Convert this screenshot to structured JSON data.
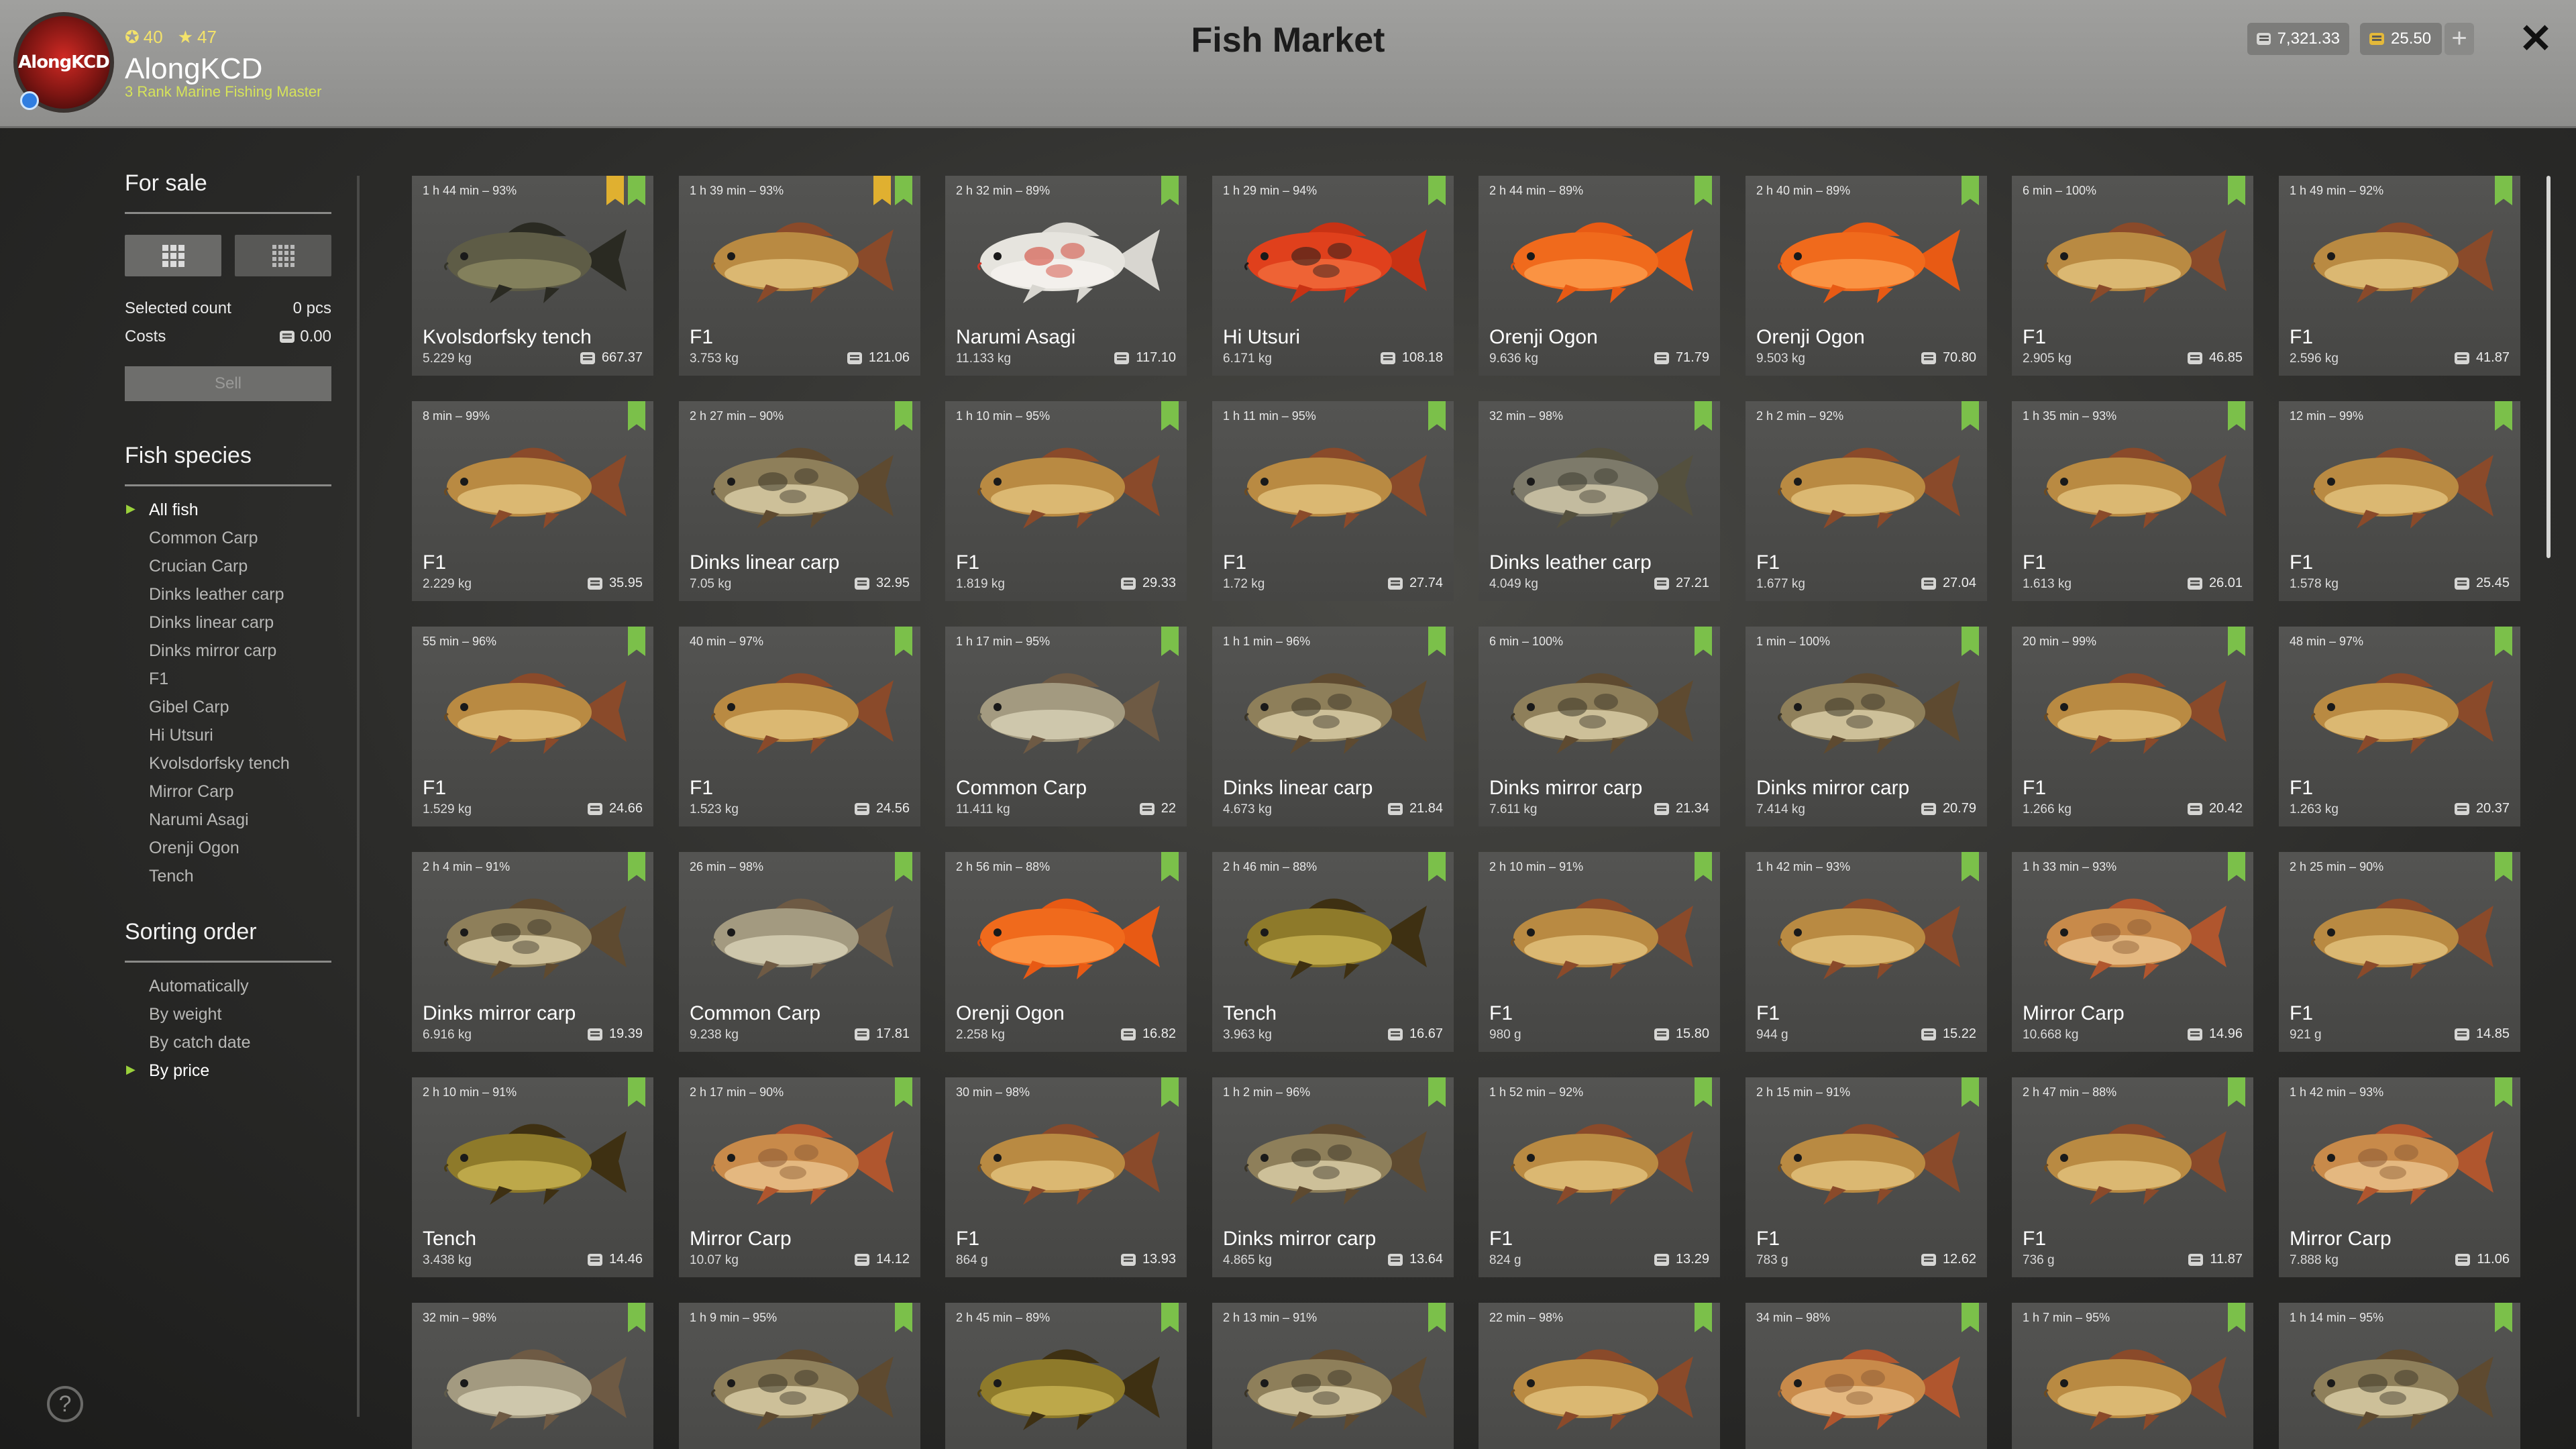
{
  "header": {
    "title": "Fish Market",
    "avatar_logo_text": "AlongKCD",
    "level_primary": "40",
    "level_secondary": "47",
    "username": "AlongKCD",
    "rank": "3 Rank Marine Fishing Master",
    "silver_balance": "7,321.33",
    "gold_balance": "25.50",
    "icons": [
      "circle-level-icon",
      "star-icon",
      "silver-coin-icon",
      "gold-coin-icon",
      "plus-icon",
      "close-icon"
    ]
  },
  "sidebar": {
    "for_sale_title": "For sale",
    "selected_count_label": "Selected count",
    "selected_count_value": "0 pcs",
    "costs_label": "Costs",
    "costs_value": "0.00",
    "sell_label": "Sell",
    "species_title": "Fish species",
    "species": [
      "All fish",
      "Common Carp",
      "Crucian Carp",
      "Dinks leather carp",
      "Dinks linear carp",
      "Dinks mirror carp",
      "F1",
      "Gibel Carp",
      "Hi Utsuri",
      "Kvolsdorfsky tench",
      "Mirror Carp",
      "Narumi Asagi",
      "Orenji Ogon",
      "Tench"
    ],
    "active_species": 0,
    "sorting_title": "Sorting order",
    "sorting": [
      "Automatically",
      "By weight",
      "By catch date",
      "By price"
    ],
    "active_sorting": 3
  },
  "help_label": "?",
  "colors": {
    "accent_green": "#7bc04a",
    "gold": "#e0b030",
    "card_bg": "#4e4e4c"
  },
  "fish": [
    {
      "time": "1 h 44 min – 93%",
      "name": "Kvolsdorfsky tench",
      "weight": "5.229 kg",
      "price": "667.37",
      "gold": true,
      "kind": "tench-dark"
    },
    {
      "time": "1 h 39 min – 93%",
      "name": "F1",
      "weight": "3.753 kg",
      "price": "121.06",
      "gold": true,
      "kind": "carp"
    },
    {
      "time": "2 h 32 min – 89%",
      "name": "Narumi Asagi",
      "weight": "11.133 kg",
      "price": "117.10",
      "gold": false,
      "kind": "koi-white"
    },
    {
      "time": "1 h 29 min – 94%",
      "name": "Hi Utsuri",
      "weight": "6.171 kg",
      "price": "108.18",
      "gold": false,
      "kind": "koi-red"
    },
    {
      "time": "2 h 44 min – 89%",
      "name": "Orenji Ogon",
      "weight": "9.636 kg",
      "price": "71.79",
      "gold": false,
      "kind": "koi-orange"
    },
    {
      "time": "2 h 40 min – 89%",
      "name": "Orenji Ogon",
      "weight": "9.503 kg",
      "price": "70.80",
      "gold": false,
      "kind": "koi-orange"
    },
    {
      "time": "6 min – 100%",
      "name": "F1",
      "weight": "2.905 kg",
      "price": "46.85",
      "gold": false,
      "kind": "carp"
    },
    {
      "time": "1 h 49 min – 92%",
      "name": "F1",
      "weight": "2.596 kg",
      "price": "41.87",
      "gold": false,
      "kind": "carp"
    },
    {
      "time": "8 min – 99%",
      "name": "F1",
      "weight": "2.229 kg",
      "price": "35.95",
      "gold": false,
      "kind": "carp"
    },
    {
      "time": "2 h 27 min – 90%",
      "name": "Dinks linear carp",
      "weight": "7.05 kg",
      "price": "32.95",
      "gold": false,
      "kind": "mirror"
    },
    {
      "time": "1 h 10 min – 95%",
      "name": "F1",
      "weight": "1.819 kg",
      "price": "29.33",
      "gold": false,
      "kind": "carp"
    },
    {
      "time": "1 h 11 min – 95%",
      "name": "F1",
      "weight": "1.72 kg",
      "price": "27.74",
      "gold": false,
      "kind": "carp"
    },
    {
      "time": "32 min – 98%",
      "name": "Dinks leather carp",
      "weight": "4.049 kg",
      "price": "27.21",
      "gold": false,
      "kind": "leather"
    },
    {
      "time": "2 h 2 min – 92%",
      "name": "F1",
      "weight": "1.677 kg",
      "price": "27.04",
      "gold": false,
      "kind": "carp"
    },
    {
      "time": "1 h 35 min – 93%",
      "name": "F1",
      "weight": "1.613 kg",
      "price": "26.01",
      "gold": false,
      "kind": "carp"
    },
    {
      "time": "12 min – 99%",
      "name": "F1",
      "weight": "1.578 kg",
      "price": "25.45",
      "gold": false,
      "kind": "carp"
    },
    {
      "time": "55 min – 96%",
      "name": "F1",
      "weight": "1.529 kg",
      "price": "24.66",
      "gold": false,
      "kind": "carp"
    },
    {
      "time": "40 min – 97%",
      "name": "F1",
      "weight": "1.523 kg",
      "price": "24.56",
      "gold": false,
      "kind": "carp"
    },
    {
      "time": "1 h 17 min – 95%",
      "name": "Common Carp",
      "weight": "11.411 kg",
      "price": "22",
      "gold": false,
      "kind": "common"
    },
    {
      "time": "1 h 1 min – 96%",
      "name": "Dinks linear carp",
      "weight": "4.673 kg",
      "price": "21.84",
      "gold": false,
      "kind": "mirror"
    },
    {
      "time": "6 min – 100%",
      "name": "Dinks mirror carp",
      "weight": "7.611 kg",
      "price": "21.34",
      "gold": false,
      "kind": "mirror"
    },
    {
      "time": "1 min – 100%",
      "name": "Dinks mirror carp",
      "weight": "7.414 kg",
      "price": "20.79",
      "gold": false,
      "kind": "mirror"
    },
    {
      "time": "20 min – 99%",
      "name": "F1",
      "weight": "1.266 kg",
      "price": "20.42",
      "gold": false,
      "kind": "carp"
    },
    {
      "time": "48 min – 97%",
      "name": "F1",
      "weight": "1.263 kg",
      "price": "20.37",
      "gold": false,
      "kind": "carp"
    },
    {
      "time": "2 h 4 min – 91%",
      "name": "Dinks mirror carp",
      "weight": "6.916 kg",
      "price": "19.39",
      "gold": false,
      "kind": "mirror"
    },
    {
      "time": "26 min – 98%",
      "name": "Common Carp",
      "weight": "9.238 kg",
      "price": "17.81",
      "gold": false,
      "kind": "common"
    },
    {
      "time": "2 h 56 min – 88%",
      "name": "Orenji Ogon",
      "weight": "2.258 kg",
      "price": "16.82",
      "gold": false,
      "kind": "koi-orange"
    },
    {
      "time": "2 h 46 min – 88%",
      "name": "Tench",
      "weight": "3.963 kg",
      "price": "16.67",
      "gold": false,
      "kind": "tench"
    },
    {
      "time": "2 h 10 min – 91%",
      "name": "F1",
      "weight": "980 g",
      "price": "15.80",
      "gold": false,
      "kind": "carp"
    },
    {
      "time": "1 h 42 min – 93%",
      "name": "F1",
      "weight": "944 g",
      "price": "15.22",
      "gold": false,
      "kind": "carp"
    },
    {
      "time": "1 h 33 min – 93%",
      "name": "Mirror Carp",
      "weight": "10.668 kg",
      "price": "14.96",
      "gold": false,
      "kind": "mirror-gold"
    },
    {
      "time": "2 h 25 min – 90%",
      "name": "F1",
      "weight": "921 g",
      "price": "14.85",
      "gold": false,
      "kind": "carp"
    },
    {
      "time": "2 h 10 min – 91%",
      "name": "Tench",
      "weight": "3.438 kg",
      "price": "14.46",
      "gold": false,
      "kind": "tench"
    },
    {
      "time": "2 h 17 min – 90%",
      "name": "Mirror Carp",
      "weight": "10.07 kg",
      "price": "14.12",
      "gold": false,
      "kind": "mirror-gold"
    },
    {
      "time": "30 min – 98%",
      "name": "F1",
      "weight": "864 g",
      "price": "13.93",
      "gold": false,
      "kind": "carp"
    },
    {
      "time": "1 h 2 min – 96%",
      "name": "Dinks mirror carp",
      "weight": "4.865 kg",
      "price": "13.64",
      "gold": false,
      "kind": "mirror"
    },
    {
      "time": "1 h 52 min – 92%",
      "name": "F1",
      "weight": "824 g",
      "price": "13.29",
      "gold": false,
      "kind": "carp"
    },
    {
      "time": "2 h 15 min – 91%",
      "name": "F1",
      "weight": "783 g",
      "price": "12.62",
      "gold": false,
      "kind": "carp"
    },
    {
      "time": "2 h 47 min – 88%",
      "name": "F1",
      "weight": "736 g",
      "price": "11.87",
      "gold": false,
      "kind": "carp"
    },
    {
      "time": "1 h 42 min – 93%",
      "name": "Mirror Carp",
      "weight": "7.888 kg",
      "price": "11.06",
      "gold": false,
      "kind": "mirror-gold"
    },
    {
      "time": "32 min – 98%",
      "name": "",
      "weight": "",
      "price": "",
      "gold": false,
      "kind": "common"
    },
    {
      "time": "1 h 9 min – 95%",
      "name": "",
      "weight": "",
      "price": "",
      "gold": false,
      "kind": "mirror"
    },
    {
      "time": "2 h 45 min – 89%",
      "name": "",
      "weight": "",
      "price": "",
      "gold": false,
      "kind": "tench"
    },
    {
      "time": "2 h 13 min – 91%",
      "name": "",
      "weight": "",
      "price": "",
      "gold": false,
      "kind": "mirror"
    },
    {
      "time": "22 min – 98%",
      "name": "",
      "weight": "",
      "price": "",
      "gold": false,
      "kind": "carp"
    },
    {
      "time": "34 min – 98%",
      "name": "",
      "weight": "",
      "price": "",
      "gold": false,
      "kind": "mirror-gold"
    },
    {
      "time": "1 h 7 min – 95%",
      "name": "",
      "weight": "",
      "price": "",
      "gold": false,
      "kind": "carp"
    },
    {
      "time": "1 h 14 min – 95%",
      "name": "",
      "weight": "",
      "price": "",
      "gold": false,
      "kind": "mirror"
    }
  ]
}
